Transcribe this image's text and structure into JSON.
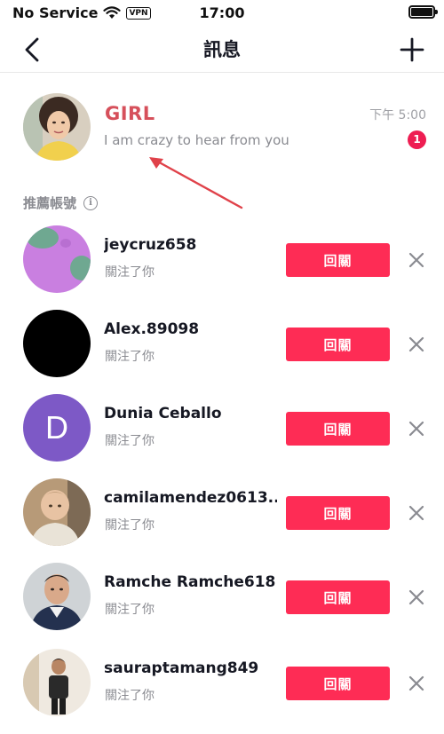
{
  "status_bar": {
    "carrier": "No Service",
    "vpn": "VPN",
    "time": "17:00",
    "icons": [
      "wifi-icon",
      "battery-icon"
    ]
  },
  "header": {
    "title": "訊息",
    "back_icon": "chevron-left-icon",
    "add_icon": "plus-icon"
  },
  "message": {
    "name": "GIRL",
    "preview": "I am crazy to hear from you",
    "time": "下午 5:00",
    "unread": "1",
    "name_color": "#d6505b"
  },
  "suggestions": {
    "label": "推薦帳號",
    "info_icon": "i",
    "items": [
      {
        "name": "jeycruz658",
        "subtitle": "關注了你",
        "button": "回關",
        "avatar": "purple-green-blobs"
      },
      {
        "name": "Alex.89098",
        "subtitle": "關注了你",
        "button": "回關",
        "avatar": "black-circle"
      },
      {
        "name": "Dunia Ceballo",
        "subtitle": "關注了你",
        "button": "回關",
        "avatar_letter": "D"
      },
      {
        "name": "camilamendez0613...",
        "subtitle": "關注了你",
        "button": "回關",
        "avatar": "child-photo"
      },
      {
        "name": "Ramche Ramche618",
        "subtitle": "關注了你",
        "button": "回關",
        "avatar": "man-photo"
      },
      {
        "name": "sauraptamang849",
        "subtitle": "關注了你",
        "button": "回關",
        "avatar": "boy-photo"
      }
    ]
  },
  "colors": {
    "accent": "#fe2c55",
    "badge": "#ee1d52",
    "muted_text": "#8a8b91",
    "arrow": "#e0424a"
  }
}
